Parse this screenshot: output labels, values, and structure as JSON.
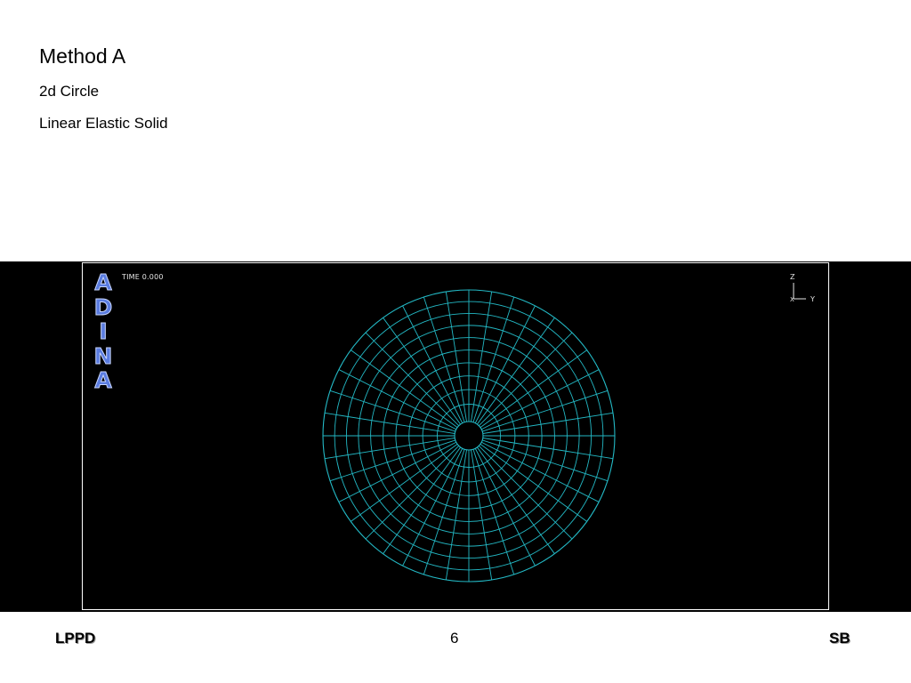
{
  "slide": {
    "title": "Method A",
    "subtitle_1": "2d Circle",
    "subtitle_2": "Linear Elastic Solid"
  },
  "figure": {
    "logo_letters": [
      "A",
      "D",
      "I",
      "N",
      "A"
    ],
    "time_label": "TIME 0.000",
    "axes": {
      "vertical_label": "Z",
      "horizontal_label": "Y",
      "origin_label": "X"
    },
    "mesh": {
      "radial_divisions": 40,
      "ring_count": 10,
      "mesh_color": "#23b8c4",
      "background_color": "#000000",
      "frame_color": "#ffffff"
    }
  },
  "footer": {
    "left": "LPPD",
    "page_number": "6",
    "right": "SB"
  },
  "colors": {
    "logo_fill": "#5a7ce0",
    "logo_outline": "#c8d6ff"
  }
}
